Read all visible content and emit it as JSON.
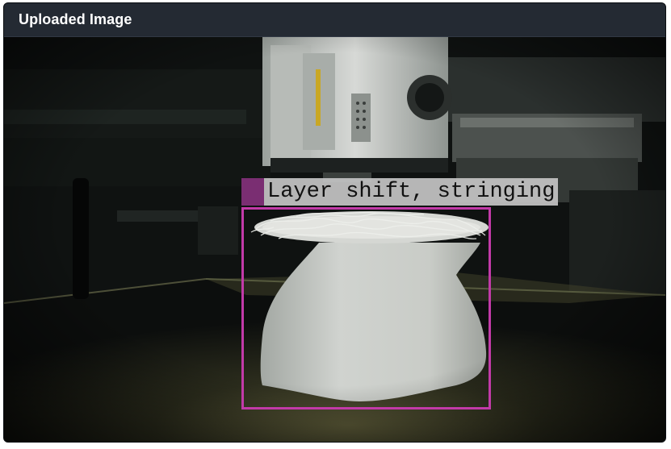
{
  "panel": {
    "title": "Uploaded Image"
  },
  "image": {
    "icon": "3d-printer-photo",
    "detections": [
      {
        "label": "Layer shift, stringing",
        "color": "#c23aa8"
      }
    ]
  },
  "colors": {
    "header_bg": "#242a33",
    "header_text": "#ffffff",
    "detection_box": "#c23aa8"
  }
}
